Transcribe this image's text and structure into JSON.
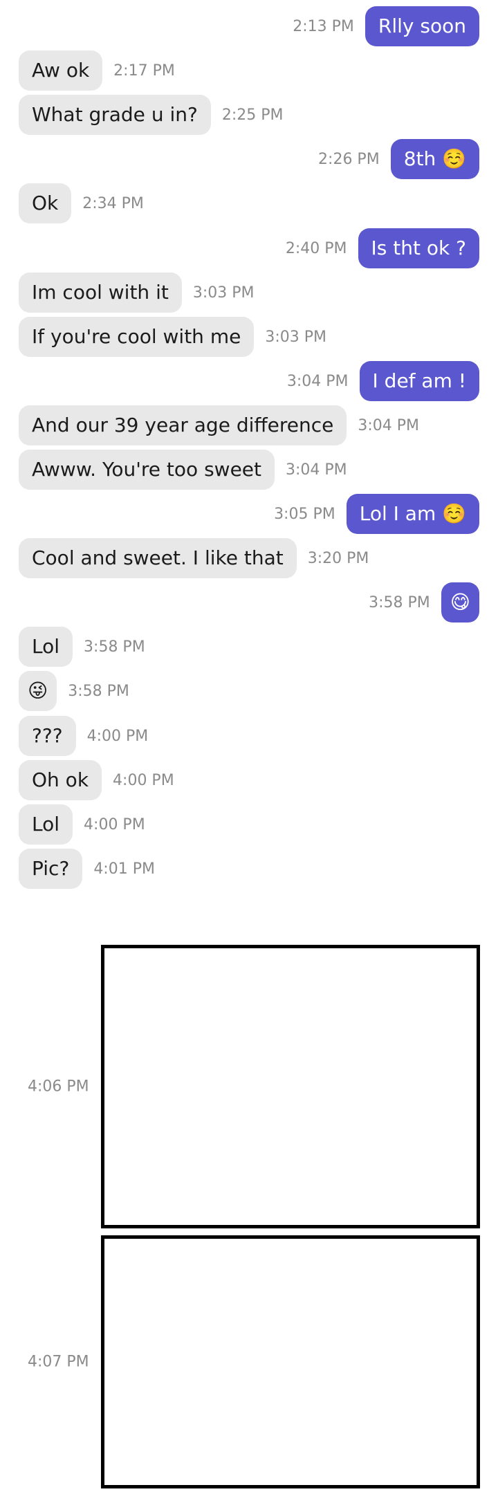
{
  "colors": {
    "incoming_bubble": "#e8e8e8",
    "outgoing_bubble": "#5a57cf",
    "timestamp": "#8a8a8a"
  },
  "messages": [
    {
      "dir": "out",
      "text": "Rlly soon",
      "time": "2:13 PM"
    },
    {
      "dir": "in",
      "text": "Aw ok",
      "time": "2:17 PM"
    },
    {
      "dir": "in",
      "text": "What grade u in?",
      "time": "2:25 PM"
    },
    {
      "dir": "out",
      "text": "8th ☺️",
      "time": "2:26 PM"
    },
    {
      "dir": "in",
      "text": "Ok",
      "time": "2:34 PM"
    },
    {
      "dir": "out",
      "text": "Is tht ok ?",
      "time": "2:40 PM"
    },
    {
      "dir": "in",
      "text": "Im cool with it",
      "time": "3:03 PM"
    },
    {
      "dir": "in",
      "text": "If you're cool with me",
      "time": "3:03 PM"
    },
    {
      "dir": "out",
      "text": "I def am !",
      "time": "3:04 PM"
    },
    {
      "dir": "in",
      "text": "And our 39 year age difference",
      "time": "3:04 PM"
    },
    {
      "dir": "in",
      "text": "Awww. You're too sweet",
      "time": "3:04 PM"
    },
    {
      "dir": "out",
      "text": "Lol I am ☺️",
      "time": "3:05 PM"
    },
    {
      "dir": "in",
      "text": "Cool and sweet. I like that",
      "time": "3:20 PM"
    },
    {
      "dir": "out",
      "text": "😋",
      "time": "3:58 PM",
      "emoji_only": true
    },
    {
      "dir": "in",
      "text": "Lol",
      "time": "3:58 PM"
    },
    {
      "dir": "in",
      "text": "😜",
      "time": "3:58 PM",
      "emoji_only": true
    },
    {
      "dir": "in",
      "text": "???",
      "time": "4:00 PM"
    },
    {
      "dir": "in",
      "text": "Oh ok",
      "time": "4:00 PM"
    },
    {
      "dir": "in",
      "text": "Lol",
      "time": "4:00 PM"
    },
    {
      "dir": "in",
      "text": "Pic?",
      "time": "4:01 PM"
    }
  ],
  "images": [
    {
      "time": "4:06 PM"
    },
    {
      "time": "4:07 PM"
    }
  ]
}
